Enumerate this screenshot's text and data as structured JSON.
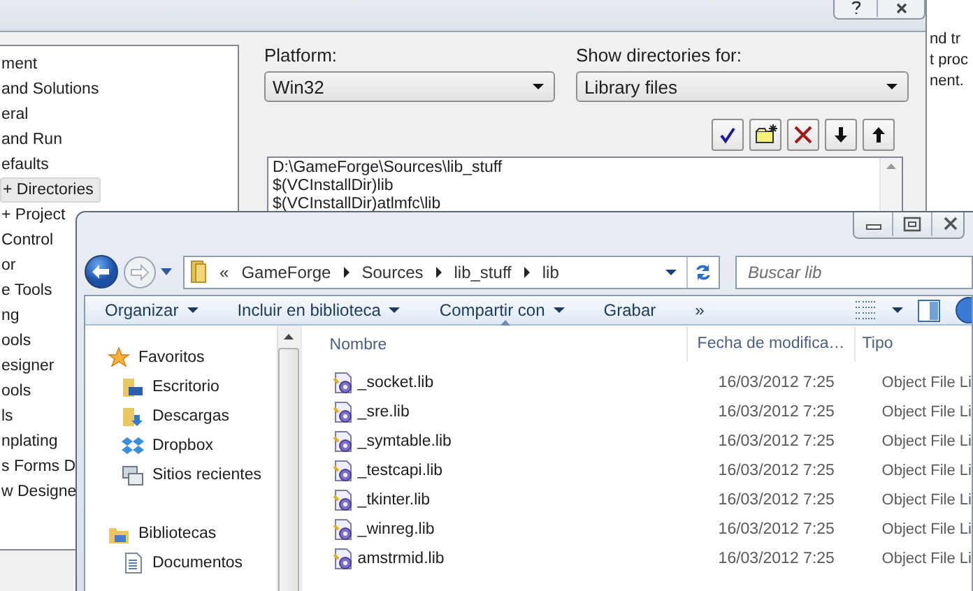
{
  "background_window": {
    "lines": [
      "nd tr",
      "t proc",
      "nent."
    ]
  },
  "options_dialog": {
    "tree": [
      {
        "label": "ment",
        "selected": false
      },
      {
        "label": "and Solutions",
        "selected": false
      },
      {
        "label": "eral",
        "selected": false
      },
      {
        "label": "and Run",
        "selected": false
      },
      {
        "label": "efaults",
        "selected": false
      },
      {
        "label": "+ Directories",
        "selected": true
      },
      {
        "label": "+ Project",
        "selected": false
      },
      {
        "label": "Control",
        "selected": false
      },
      {
        "label": "or",
        "selected": false
      },
      {
        "label": "e Tools",
        "selected": false
      },
      {
        "label": "ng",
        "selected": false
      },
      {
        "label": "ools",
        "selected": false
      },
      {
        "label": "esigner",
        "selected": false
      },
      {
        "label": "ools",
        "selected": false
      },
      {
        "label": "ls",
        "selected": false
      },
      {
        "label": "nplating",
        "selected": false
      },
      {
        "label": "s Forms D",
        "selected": false
      },
      {
        "label": "w Designe",
        "selected": false
      }
    ],
    "platform": {
      "label": "Platform:",
      "value": "Win32"
    },
    "show_for": {
      "label": "Show directories for:",
      "value": "Library files"
    },
    "directories": [
      "D:\\GameForge\\Sources\\lib_stuff",
      "$(VCInstallDir)lib",
      "$(VCInstallDir)atlmfc\\lib"
    ]
  },
  "explorer": {
    "address": {
      "prefix": "«",
      "crumbs": [
        "GameForge",
        "Sources",
        "lib_stuff",
        "lib"
      ]
    },
    "search": {
      "placeholder": "Buscar lib"
    },
    "toolbar": [
      {
        "label": "Organizar",
        "has_menu": true
      },
      {
        "label": "Incluir en biblioteca",
        "has_menu": true
      },
      {
        "label": "Compartir con",
        "has_menu": true
      },
      {
        "label": "Grabar",
        "has_menu": false
      }
    ],
    "overflow": "»",
    "nav": [
      {
        "label": "Favoritos",
        "kind": "group"
      },
      {
        "label": "Escritorio",
        "kind": "item"
      },
      {
        "label": "Descargas",
        "kind": "item"
      },
      {
        "label": "Dropbox",
        "kind": "item"
      },
      {
        "label": "Sitios recientes",
        "kind": "item"
      },
      {
        "label": "Bibliotecas",
        "kind": "group"
      },
      {
        "label": "Documentos",
        "kind": "item"
      }
    ],
    "columns": [
      "Nombre",
      "Fecha de modifica…",
      "Tipo"
    ],
    "rows": [
      {
        "name": "_socket.lib",
        "date": "16/03/2012 7:25",
        "type": "Object File Li"
      },
      {
        "name": "_sre.lib",
        "date": "16/03/2012 7:25",
        "type": "Object File Li"
      },
      {
        "name": "_symtable.lib",
        "date": "16/03/2012 7:25",
        "type": "Object File Li"
      },
      {
        "name": "_testcapi.lib",
        "date": "16/03/2012 7:25",
        "type": "Object File Li"
      },
      {
        "name": "_tkinter.lib",
        "date": "16/03/2012 7:25",
        "type": "Object File Li"
      },
      {
        "name": "_winreg.lib",
        "date": "16/03/2012 7:25",
        "type": "Object File Li"
      },
      {
        "name": "amstrmid.lib",
        "date": "16/03/2012 7:25",
        "type": "Object File Li"
      }
    ]
  }
}
